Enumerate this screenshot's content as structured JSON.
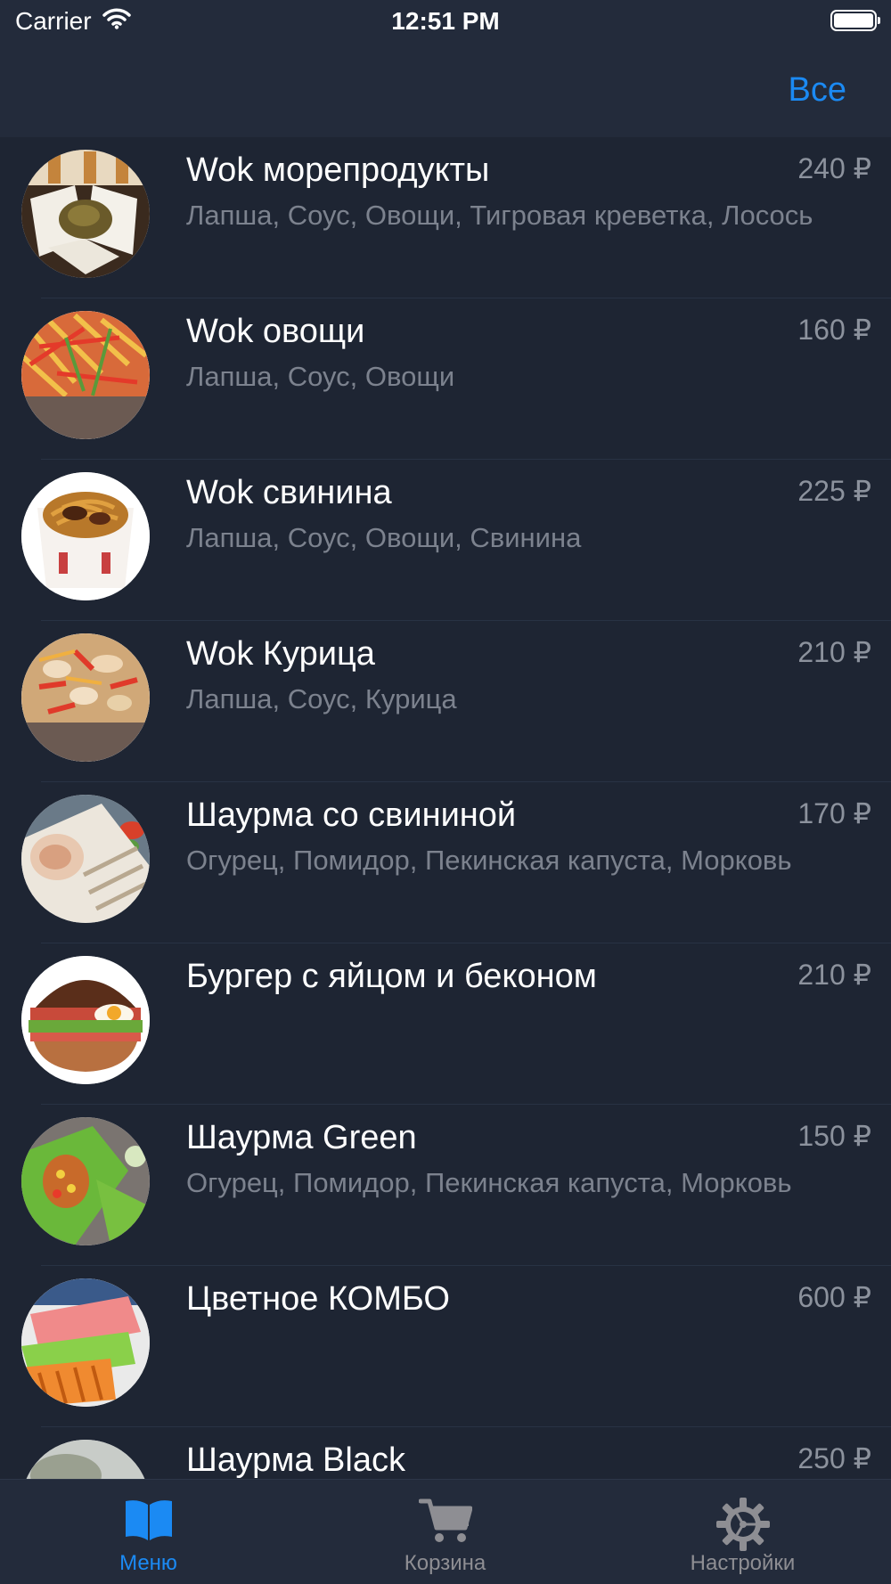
{
  "status_bar": {
    "carrier": "Carrier",
    "time": "12:51 PM"
  },
  "nav": {
    "all_label": "Все",
    "accent_color": "#1b8af3"
  },
  "menu_items": [
    {
      "title": "Wok морепродукты",
      "price": "240 ₽",
      "description": "Лапша, Соус, Овощи, Тигровая креветка, Лосось",
      "image": "wok-seafood-photo"
    },
    {
      "title": "Wok овощи",
      "price": "160 ₽",
      "description": "Лапша, Соус, Овощи",
      "image": "wok-vegetables-photo"
    },
    {
      "title": "Wok свинина",
      "price": "225 ₽",
      "description": "Лапша, Соус, Овощи, Свинина",
      "image": "wok-pork-photo"
    },
    {
      "title": "Wok Курица",
      "price": "210 ₽",
      "description": "Лапша, Соус, Курица",
      "image": "wok-chicken-photo"
    },
    {
      "title": "Шаурма со свининой",
      "price": "170 ₽",
      "description": "Огурец, Помидор, Пекинская капуста, Морковь",
      "image": "shawarma-pork-photo"
    },
    {
      "title": "Бургер с яйцом и беконом",
      "price": "210 ₽",
      "description": "",
      "image": "burger-egg-bacon-photo"
    },
    {
      "title": "Шаурма Green",
      "price": "150 ₽",
      "description": "Огурец, Помидор, Пекинская капуста, Морковь",
      "image": "shawarma-green-photo"
    },
    {
      "title": "Цветное КОМБО",
      "price": "600 ₽",
      "description": "",
      "image": "color-combo-photo"
    },
    {
      "title": "Шаурма Black",
      "price": "250 ₽",
      "description": "",
      "image": "shawarma-black-photo"
    }
  ],
  "tab_bar": {
    "tabs": [
      {
        "label": "Меню",
        "icon": "book-icon",
        "active": true
      },
      {
        "label": "Корзина",
        "icon": "cart-icon",
        "active": false
      },
      {
        "label": "Настройки",
        "icon": "gear-icon",
        "active": false
      }
    ],
    "active_color": "#1b8af3",
    "inactive_color": "#8e8e93"
  }
}
